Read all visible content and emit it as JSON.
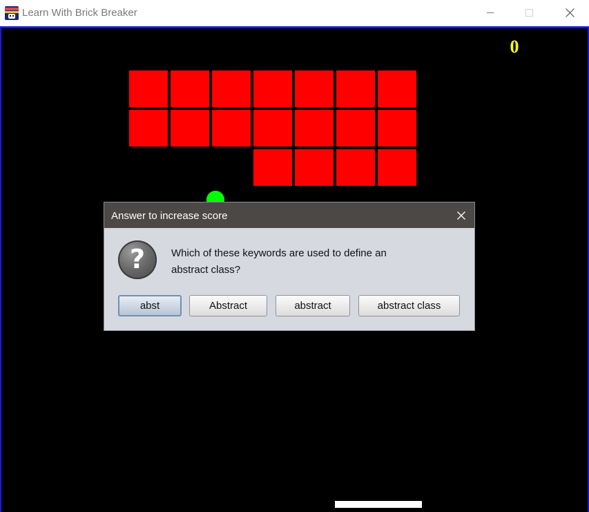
{
  "window": {
    "title": "Learn With Brick Breaker",
    "icon": "brick-breaker-app-icon",
    "controls": [
      "minimize-icon",
      "maximize-icon",
      "close-icon"
    ]
  },
  "game": {
    "score": "0",
    "background_color": "#000000",
    "brick_color": "#ff0000",
    "ball_color": "#00ff00",
    "paddle_color": "#ffffff",
    "score_color": "#ffff00",
    "brick_grid": {
      "columns": 7,
      "rows": [
        [
          1,
          1,
          1,
          1,
          1,
          1,
          1
        ],
        [
          1,
          1,
          1,
          1,
          1,
          1,
          1
        ],
        [
          0,
          0,
          0,
          1,
          1,
          1,
          1
        ]
      ]
    }
  },
  "dialog": {
    "title": "Answer to increase score",
    "icon": "question-icon",
    "question_line1": "Which of these keywords are used to define an",
    "question_line2": "abstract class?",
    "options": [
      "abst",
      "Abstract",
      "abstract",
      "abstract class"
    ],
    "selected_option": "abst"
  }
}
